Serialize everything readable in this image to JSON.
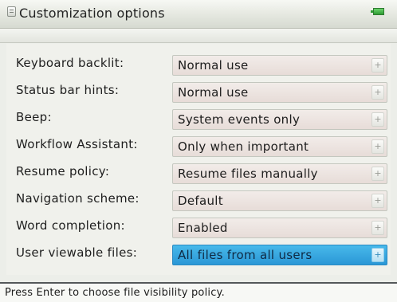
{
  "window": {
    "title": "Customization options",
    "icons": {
      "title": "document-icon",
      "status": "battery-icon"
    }
  },
  "settings": [
    {
      "label": "Keyboard backlit:",
      "value": "Normal use"
    },
    {
      "label": "Status bar hints:",
      "value": "Normal use"
    },
    {
      "label": "Beep:",
      "value": "System events only"
    },
    {
      "label": "Workflow Assistant:",
      "value": "Only when important"
    },
    {
      "label": "Resume policy:",
      "value": "Resume files manually"
    },
    {
      "label": "Navigation scheme:",
      "value": "Default"
    },
    {
      "label": "Word completion:",
      "value": "Enabled"
    },
    {
      "label": "User viewable files:",
      "value": "All files from all users",
      "selected": true
    }
  ],
  "dropdown_glyph": "+",
  "status_bar": {
    "hint": "Press Enter to choose file visibility policy."
  },
  "colors": {
    "selection": "#3aa9e2",
    "status_icon": "#3fae45"
  }
}
